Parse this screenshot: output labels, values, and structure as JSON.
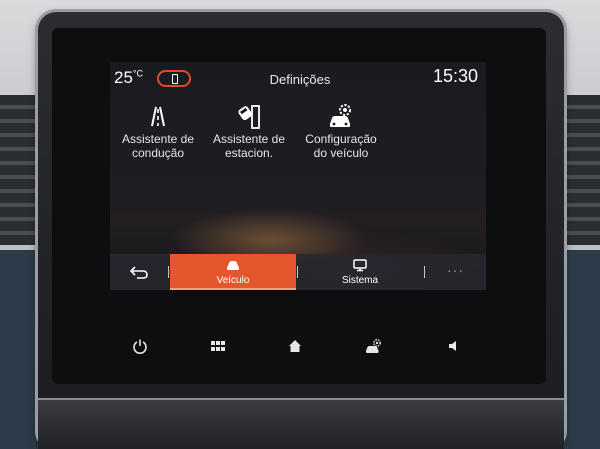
{
  "status_bar": {
    "temperature_value": "25",
    "temperature_unit": "°C",
    "phone_status_icon": "phone-icon",
    "title": "Definições",
    "clock": "15:30"
  },
  "menu": {
    "items": [
      {
        "label": "Assistente de\ncondução",
        "icon": "lane-assist-icon"
      },
      {
        "label": "Assistente de\nestacion.",
        "icon": "parking-assist-icon"
      },
      {
        "label": "Configuração\ndo veículo",
        "icon": "car-settings-icon"
      }
    ]
  },
  "bottom_bar": {
    "back_icon": "back-arrow-icon",
    "tabs": [
      {
        "label": "Veículo",
        "icon": "car-icon",
        "active": true
      },
      {
        "label": "Sistema",
        "icon": "monitor-icon",
        "active": false
      }
    ],
    "more_label": "···"
  },
  "hardware_buttons": [
    {
      "icon": "power-icon"
    },
    {
      "icon": "grid-menu-icon"
    },
    {
      "icon": "home-icon"
    },
    {
      "icon": "car-settings-icon"
    },
    {
      "icon": "volume-icon"
    }
  ],
  "colors": {
    "accent": "#e4572e",
    "phone_pill_border": "#e04a2a",
    "text": "#ffffff"
  }
}
